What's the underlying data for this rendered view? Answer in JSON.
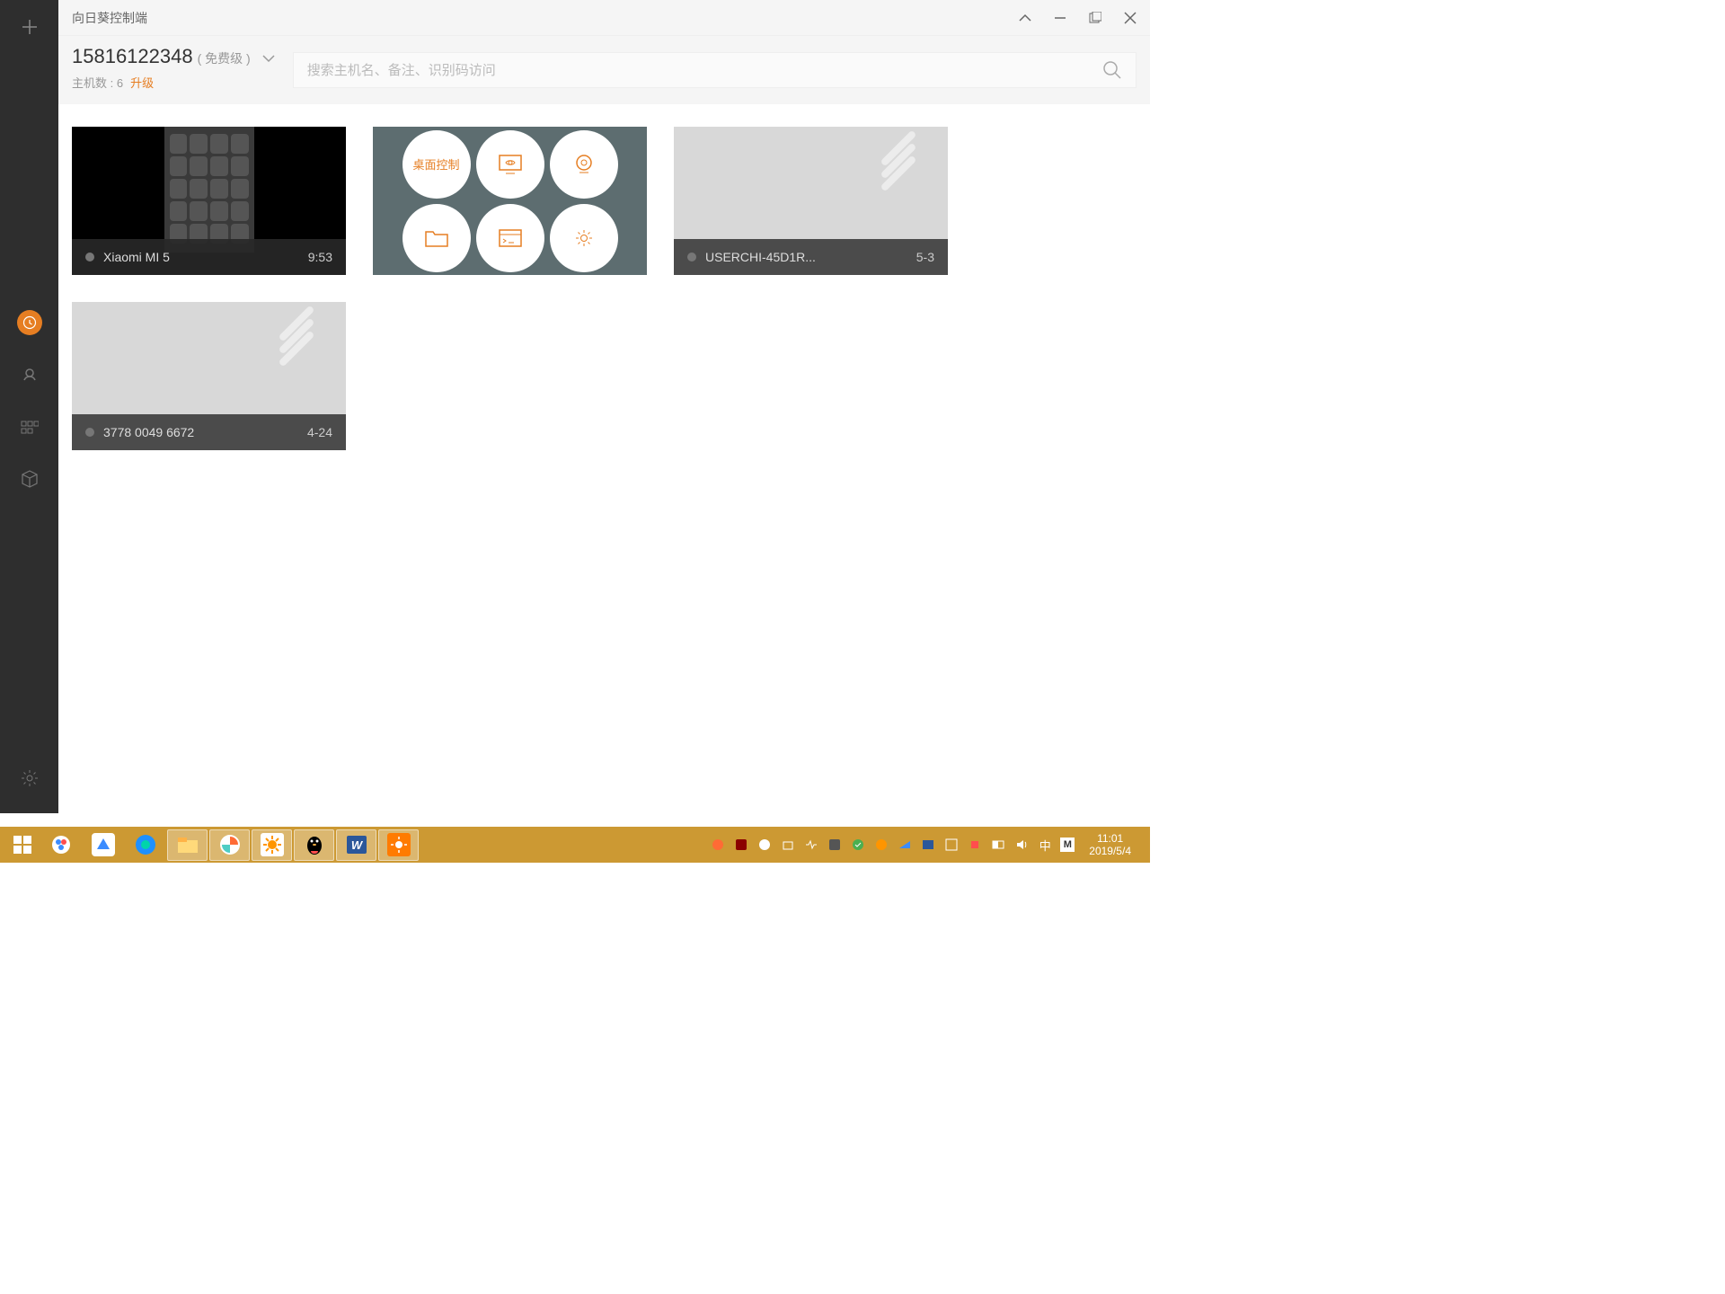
{
  "window": {
    "title": "向日葵控制端"
  },
  "account": {
    "id": "15816122348",
    "level": "( 免费级 )",
    "host_count_label": "主机数 : 6",
    "upgrade": "升级"
  },
  "search": {
    "placeholder": "搜索主机名、备注、识别码访问"
  },
  "controls": {
    "desktop": "桌面控制"
  },
  "cards": [
    {
      "name": "Xiaomi MI 5",
      "time": "9:53"
    },
    {
      "name": "USERCHI-45D1R...",
      "time": "5-3"
    },
    {
      "name": "3778 0049 6672",
      "time": "4-24"
    }
  ],
  "clock": {
    "time": "11:01",
    "date": "2019/5/4"
  },
  "ime": "中",
  "m_label": "M"
}
